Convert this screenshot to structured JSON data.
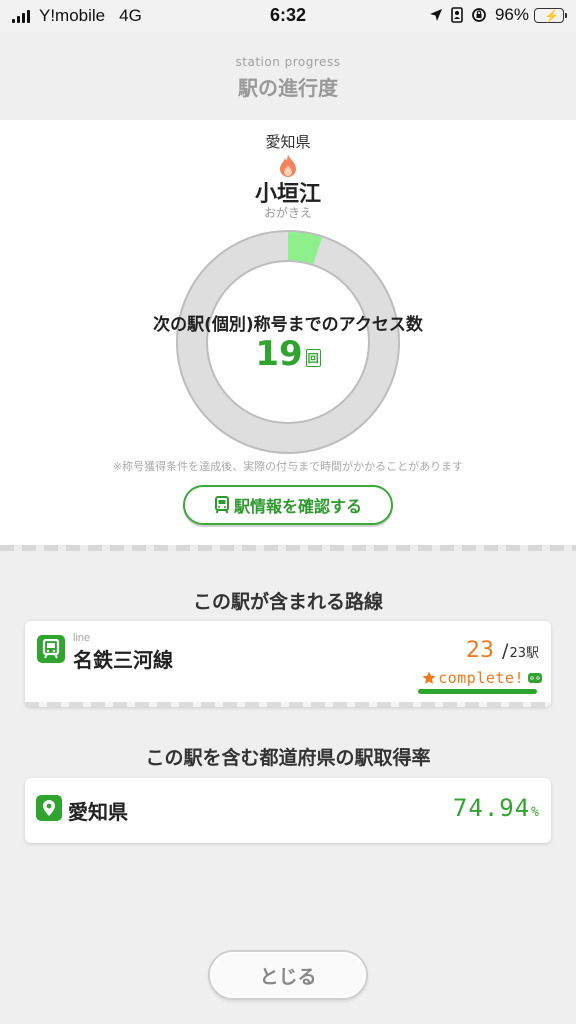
{
  "status_bar": {
    "carrier": "Y!mobile",
    "network": "4G",
    "time": "6:32",
    "battery": "96%",
    "icons": [
      "signal-icon",
      "location-arrow-icon",
      "portrait-lock-icon",
      "rotation-lock-icon",
      "battery-charging-icon"
    ]
  },
  "header": {
    "subtitle": "station progress",
    "title": "駅の進行度"
  },
  "station": {
    "prefecture": "愛知県",
    "name": "小垣江",
    "kana": "おがきえ",
    "icon": "flame-icon",
    "access_label": "次の駅(個別)称号までのアクセス数",
    "access_count": "19",
    "access_unit": "回",
    "progress_fraction": 0.05,
    "note": "※称号獲得条件を達成後、実際の付与まで時間がかかることがあります",
    "info_button": "駅情報を確認する"
  },
  "lines_section": {
    "title": "この駅が含まれる路線",
    "lines": [
      {
        "tag": "line",
        "name": "名鉄三河線",
        "acquired": "23",
        "slash": "/",
        "total": "23駅",
        "complete_label": "complete!"
      }
    ]
  },
  "prefecture_section": {
    "title": "この駅を含む都道府県の駅取得率",
    "name": "愛知県",
    "rate": "74.94",
    "unit": "%"
  },
  "close_button": "とじる",
  "colors": {
    "accent_green": "#2fa52f",
    "progress_green": "#8df08d",
    "ring_gray": "#dedede",
    "orange": "#f07a1c"
  }
}
